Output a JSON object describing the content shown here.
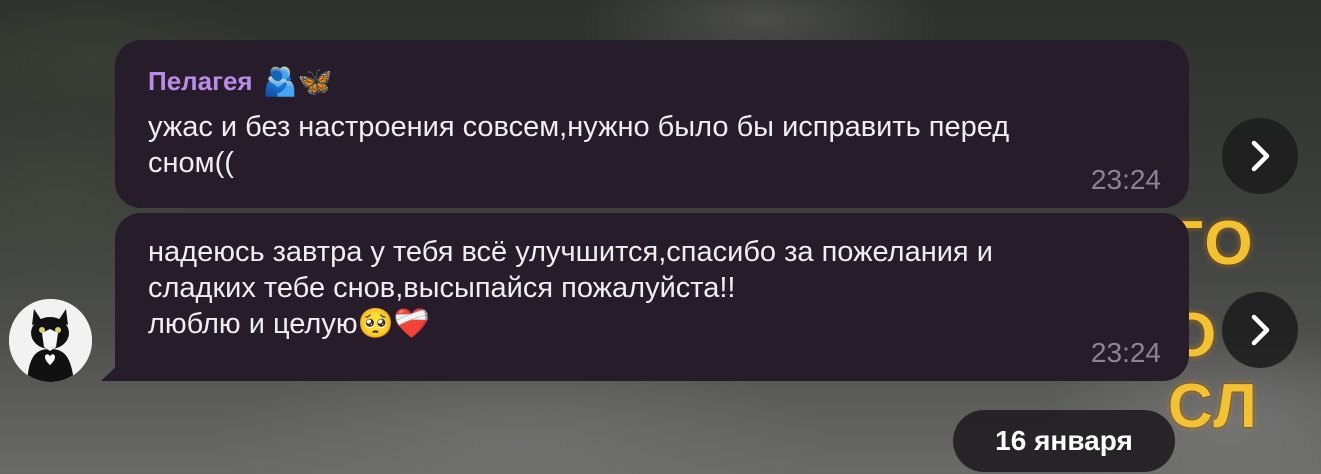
{
  "background": {
    "overlay_text_top": "ГО",
    "overlay_text_bottom": "О СЛ",
    "overlay_color": "#f2c233"
  },
  "messages": [
    {
      "sender": "Пелагея",
      "sender_emoji": "🫂🦋",
      "sender_color": "#b98ce8",
      "text": "ужас и без настроения совсем,нужно было бы исправить перед\nсном((",
      "time": "23:24",
      "forward_icon": "chevron-right-icon"
    },
    {
      "text": "надеюсь завтра у тебя всё улучшится,спасибо за пожелания и\nсладких тебе снов,высыпайся пожалуйста!!\nлюблю и целую",
      "text_emoji": "🥺❤️‍🩹",
      "time": "23:24",
      "avatar": "cat-avatar",
      "forward_icon": "chevron-right-icon"
    }
  ],
  "date_separator": "16 января",
  "colors": {
    "bubble": "#271c2a",
    "time": "#8e8297",
    "text": "#f1eef3"
  }
}
